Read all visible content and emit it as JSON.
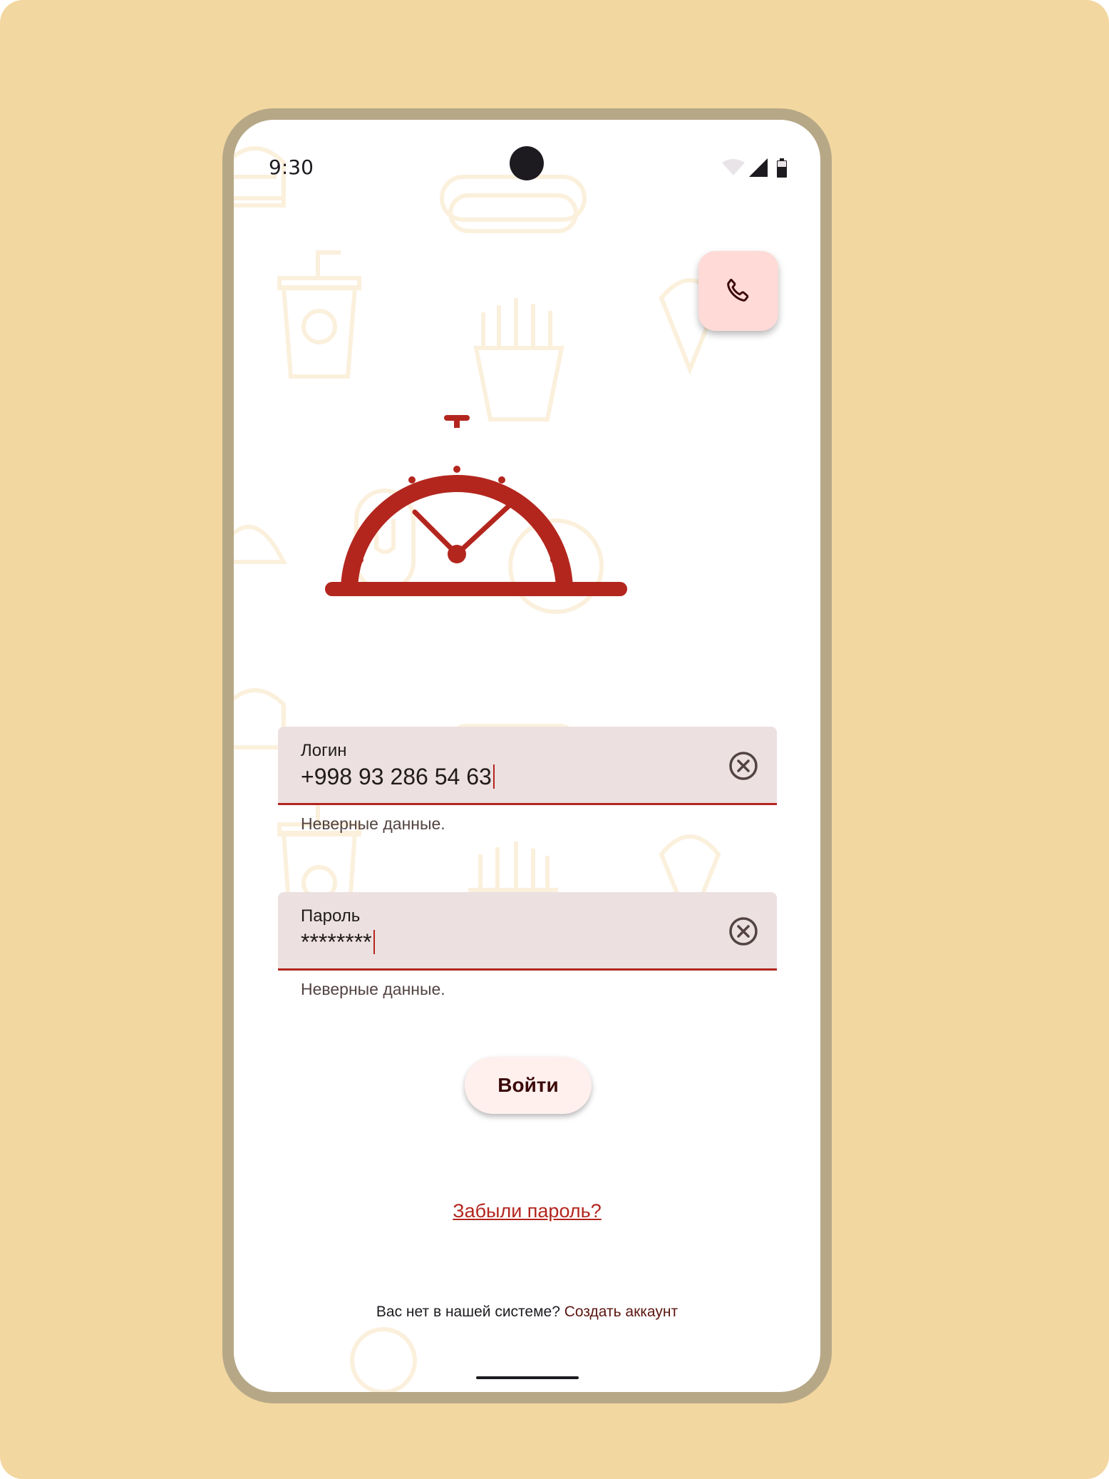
{
  "status_bar": {
    "time": "9:30"
  },
  "phone_button": {
    "icon": "phone-icon"
  },
  "login_field": {
    "label": "Логин",
    "value": "+998 93 286 54 63",
    "error_text": "Неверные данные.",
    "clear_icon": "cancel-circle-icon"
  },
  "password_field": {
    "label": "Пароль",
    "value": "********",
    "error_text": "Неверные данные.",
    "clear_icon": "cancel-circle-icon"
  },
  "login_button": {
    "label": "Войти"
  },
  "forgot_password": {
    "label": "Забыли пароль?"
  },
  "signup": {
    "prompt": "Вас нет в нашей системе?",
    "link": "Создать аккаунт"
  },
  "colors": {
    "page_background": "#F3D7A0",
    "accent": "#B3261E",
    "field_background": "#ECE0E0",
    "fab_background": "#FFDAD6"
  }
}
